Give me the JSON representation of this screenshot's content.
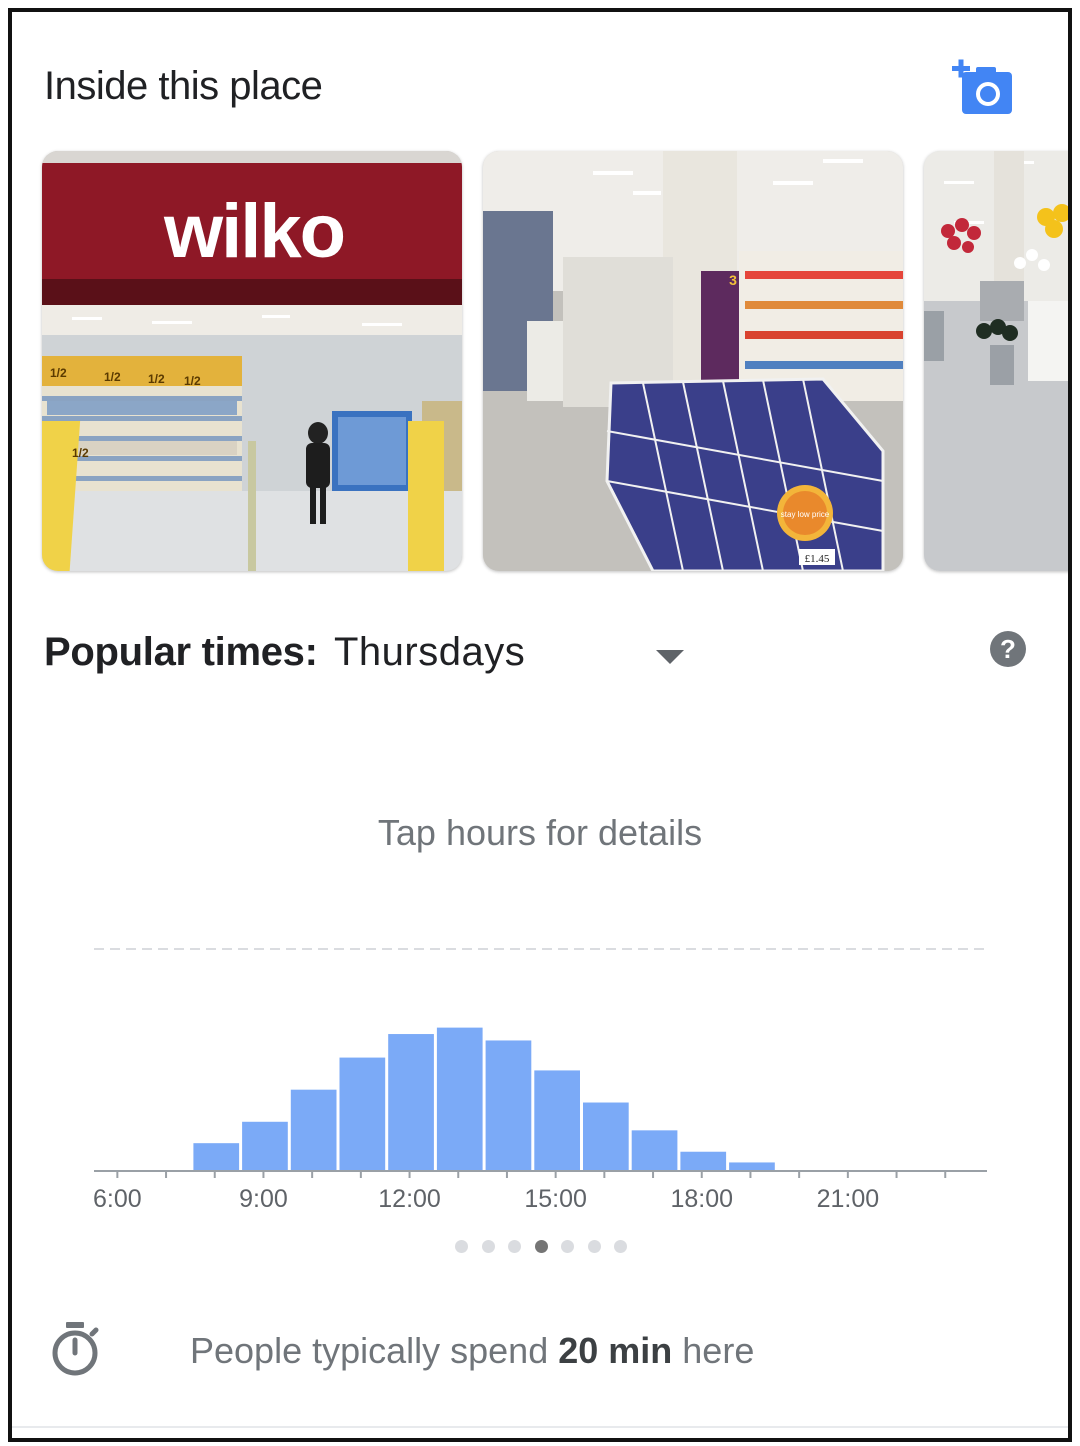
{
  "section": {
    "title": "Inside this place"
  },
  "photos": [
    {
      "sign_text": "wilko",
      "shelf_tags": [
        "1/2",
        "1/2",
        "1/2",
        "1/2",
        "1/2"
      ]
    },
    {
      "price_tag": "£1.45",
      "promo_badge": "stay low price",
      "aisle_marker": "3"
    },
    {}
  ],
  "popular_times": {
    "label": "Popular times:",
    "day": "Thursdays",
    "hint": "Tap hours for details"
  },
  "chart_data": {
    "type": "bar",
    "categories": [
      "6:00",
      "7:00",
      "8:00",
      "9:00",
      "10:00",
      "11:00",
      "12:00",
      "13:00",
      "14:00",
      "15:00",
      "16:00",
      "17:00",
      "18:00",
      "19:00",
      "20:00",
      "21:00",
      "22:00",
      "23:00"
    ],
    "values": [
      0,
      0,
      13,
      23,
      38,
      53,
      64,
      67,
      61,
      47,
      32,
      19,
      9,
      4,
      0,
      0,
      0,
      0
    ],
    "tick_labels": [
      "6:00",
      "9:00",
      "12:00",
      "15:00",
      "18:00",
      "21:00"
    ],
    "ylim": [
      0,
      100
    ],
    "grid": "dashed reference line at top",
    "bar_color": "#7baaf7"
  },
  "pagination": {
    "count": 7,
    "active_index": 3
  },
  "visit_duration": {
    "prefix": "People typically spend ",
    "value": "20 min",
    "suffix": " here"
  },
  "colors": {
    "accent": "#4285f4",
    "bar": "#7baaf7",
    "text_secondary": "#70757a",
    "icon_gray": "#757575"
  },
  "icons": {
    "add_photo": "add-photo-camera-icon",
    "dropdown": "dropdown-arrow-icon",
    "help": "help-icon",
    "timer": "timer-icon"
  }
}
